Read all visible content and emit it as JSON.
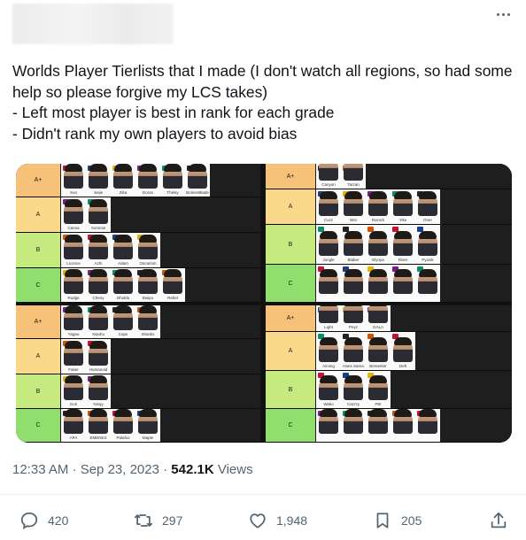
{
  "tweet": {
    "text": "Worlds Player Tierlists that I made (I don't watch all regions, so had some help so please forgive my LCS takes)\n- Left most player is best in rank for each grade\n- Didn't rank my own players to avoid bias",
    "timestamp": "12:33 AM · Sep 23, 2023 · ",
    "views_count": "542.1K",
    "views_label": " Views"
  },
  "actions": {
    "replies": "420",
    "reposts": "297",
    "likes": "1,948",
    "bookmarks": "205"
  },
  "icons": {
    "more": "more-horizontal-icon",
    "reply": "reply-icon",
    "repost": "repost-icon",
    "like": "heart-icon",
    "bookmark": "bookmark-icon",
    "share": "share-icon"
  },
  "colors": {
    "text": "#0f1419",
    "muted": "#536471",
    "tier_a_plus": "#f6c27a",
    "tier_a": "#fbd98a",
    "tier_b": "#c7ea7e",
    "tier_c": "#8fde6e"
  },
  "tierlists": [
    {
      "tiers": [
        {
          "label": "A+",
          "players": [
            "Xun",
            "Jiejie",
            "Zika",
            "Doran",
            "Thelsy",
            "BrokenBlade"
          ]
        },
        {
          "label": "A",
          "players": [
            "Canna",
            "Sommis"
          ]
        },
        {
          "label": "B",
          "players": [
            "Licorice",
            "Azhi",
            "Adam",
            "Oscarinin"
          ]
        },
        {
          "label": "C",
          "players": [
            "Rudge",
            "Cheny",
            "Dhokla",
            "Bwipo",
            "Rebel"
          ]
        }
      ]
    },
    {
      "tiers": [
        {
          "label": "A+",
          "players": [
            "Canyon",
            "Tarzan"
          ]
        },
        {
          "label": "A",
          "players": [
            "Cuzz",
            "Wei",
            "Razork",
            "Yike",
            "Oner"
          ]
        },
        {
          "label": "B",
          "players": [
            "Jungle",
            "Blaber",
            "Elyoya",
            "River",
            "Pyosik"
          ]
        },
        {
          "label": "C",
          "players": [
            "",
            "",
            "",
            "",
            ""
          ]
        }
      ]
    },
    {
      "tiers": [
        {
          "label": "A+",
          "players": [
            "Yagao",
            "Xiaohu",
            "Caps",
            "Shanks"
          ]
        },
        {
          "label": "A",
          "players": [
            "Faker",
            "Humanoid"
          ]
        },
        {
          "label": "B",
          "players": [
            "Gori",
            "Nisqy"
          ]
        },
        {
          "label": "C",
          "players": [
            "APA",
            "EMENES",
            "Palafox",
            "Maple"
          ]
        }
      ]
    },
    {
      "tiers": [
        {
          "label": "A+",
          "players": [
            "Light",
            "Peyz",
            "GALA"
          ]
        },
        {
          "label": "A",
          "players": [
            "Aiming",
            "Hans Sama",
            "Berserker",
            "Deft"
          ]
        },
        {
          "label": "B",
          "players": [
            "Wako",
            "Carzzy",
            "FBI"
          ]
        },
        {
          "label": "C",
          "players": [
            "",
            "",
            "",
            "",
            ""
          ]
        }
      ]
    }
  ]
}
